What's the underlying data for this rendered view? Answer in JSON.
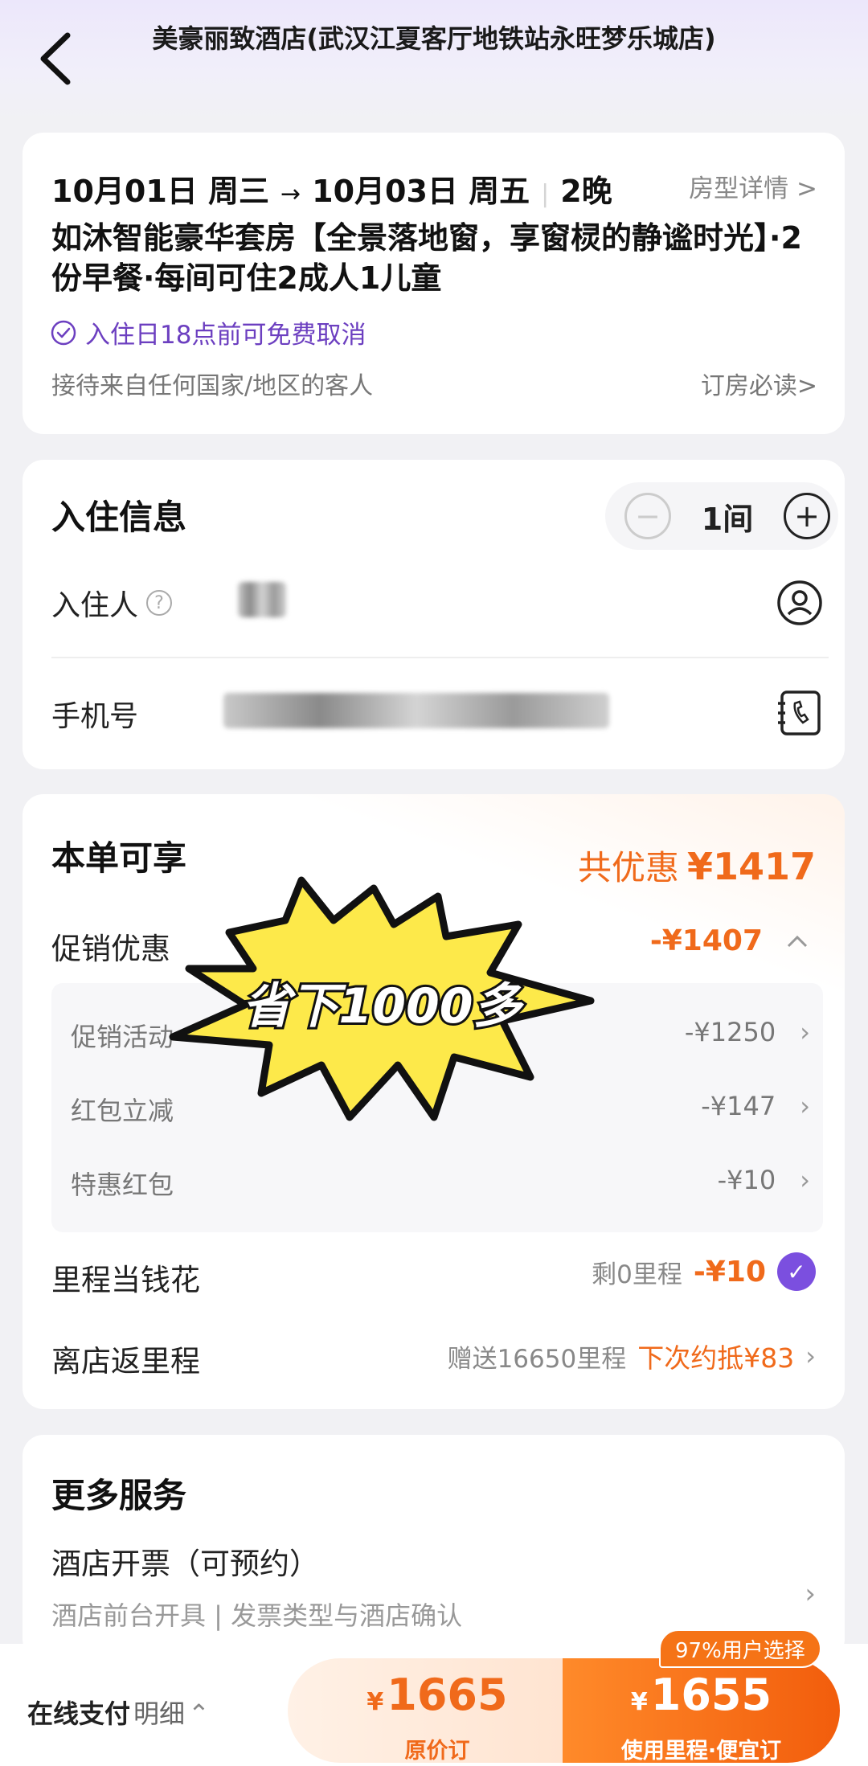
{
  "header": {
    "title": "美豪丽致酒店(武汉江夏客厅地铁站永旺梦乐城店)"
  },
  "booking": {
    "checkin": "10月01日 周三",
    "arrow": "→",
    "checkout": "10月03日 周五",
    "nights": "2晚",
    "room_detail_link": "房型详情 >",
    "room_name": "如沐智能豪华套房【全景落地窗，享窗棂的静谧时光】·2份早餐·每间可住2成人1儿童",
    "cancel_policy": "入住日18点前可免费取消",
    "guest_note": "接待来自任何国家/地区的客人",
    "must_read": "订房必读>"
  },
  "checkin_info": {
    "title": "入住信息",
    "room_count": "1间",
    "guest_label": "入住人",
    "phone_label": "手机号"
  },
  "discounts": {
    "title": "本单可享",
    "total_label": "共优惠",
    "total_amount": "¥1417",
    "promo_label": "促销优惠",
    "promo_amount": "-¥1407",
    "items": [
      {
        "label": "促销活动",
        "amount": "-¥1250"
      },
      {
        "label": "红包立减",
        "amount": "-¥147"
      },
      {
        "label": "特惠红包",
        "amount": "-¥10"
      }
    ],
    "mileage_spend_label": "里程当钱花",
    "mileage_remaining": "剩0里程",
    "mileage_spend_amount": "-¥10",
    "mileage_return_label": "离店返里程",
    "mileage_return_note": "赠送16650里程",
    "mileage_return_value": "下次约抵¥83",
    "sticker_text": "省下1000多"
  },
  "more_services": {
    "title": "更多服务",
    "invoice_title": "酒店开票（可预约）",
    "invoice_sub": "酒店前台开具 | 发票类型与酒店确认"
  },
  "bottom_bar": {
    "pay_label": "在线支付",
    "detail_label": "明细",
    "original_currency": "¥",
    "original_price": "1665",
    "original_label": "原价订",
    "mileage_currency": "¥",
    "mileage_price": "1655",
    "mileage_label": "使用里程·便宜订",
    "badge": "97%用户选择"
  },
  "colors": {
    "accent_orange": "#f06a1b",
    "accent_purple": "#7b4fdf",
    "sticker_yellow": "#fde94a"
  }
}
